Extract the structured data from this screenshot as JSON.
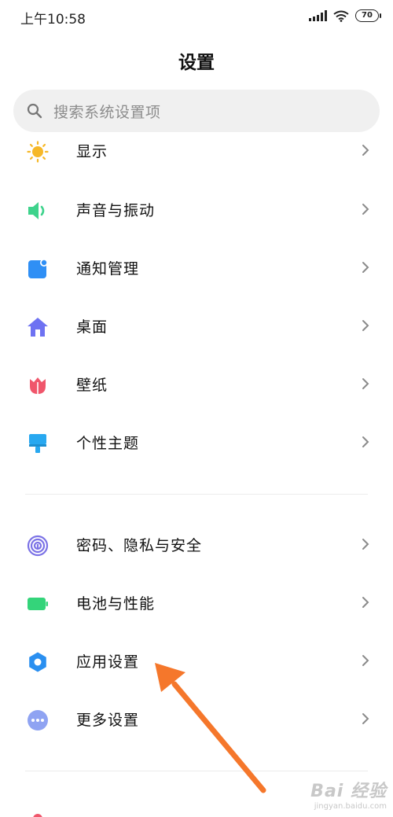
{
  "status_bar": {
    "time": "上午10:58",
    "battery": "70"
  },
  "header": {
    "title": "设置"
  },
  "search": {
    "placeholder": "搜索系统设置项"
  },
  "groups": [
    {
      "items": [
        {
          "label": "显示",
          "icon": "sun-icon",
          "color": "#f6b828"
        },
        {
          "label": "声音与振动",
          "icon": "speaker-icon",
          "color": "#3ed38c"
        },
        {
          "label": "通知管理",
          "icon": "notification-icon",
          "color": "#2f8ff5"
        },
        {
          "label": "桌面",
          "icon": "home-icon",
          "color": "#6e72f2"
        },
        {
          "label": "壁纸",
          "icon": "tulip-icon",
          "color": "#f0566b"
        },
        {
          "label": "个性主题",
          "icon": "brush-icon",
          "color": "#28a8f0"
        }
      ]
    },
    {
      "items": [
        {
          "label": "密码、隐私与安全",
          "icon": "fingerprint-icon",
          "color": "#7b72e6"
        },
        {
          "label": "电池与性能",
          "icon": "battery-icon",
          "color": "#34d47a"
        },
        {
          "label": "应用设置",
          "icon": "gear-icon",
          "color": "#2a8ff0"
        },
        {
          "label": "更多设置",
          "icon": "more-icon",
          "color": "#8fa3f2"
        }
      ]
    },
    {
      "items": [
        {
          "label": "",
          "icon": "account-icon",
          "color": "#f0566b"
        }
      ]
    }
  ],
  "annotation": {
    "arrow_color": "#f5772b"
  },
  "watermark": {
    "main": "Bai 经验",
    "sub": "jingyan.baidu.com"
  }
}
